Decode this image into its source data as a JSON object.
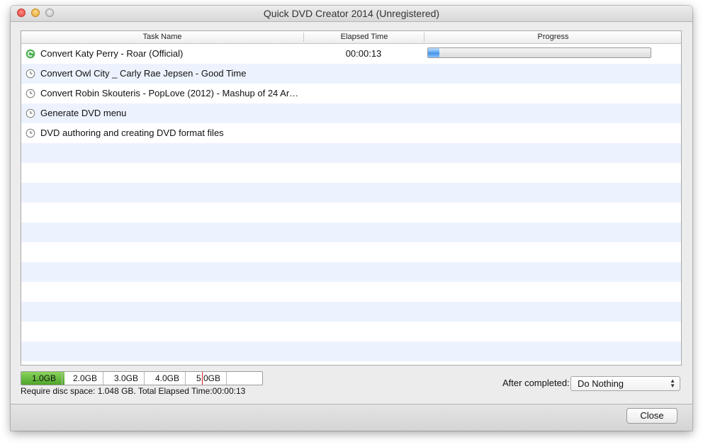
{
  "window": {
    "title": "Quick DVD Creator 2014 (Unregistered)"
  },
  "table": {
    "headers": {
      "task_name": "Task Name",
      "elapsed_time": "Elapsed Time",
      "progress": "Progress"
    },
    "tasks": [
      {
        "name": "Convert Katy Perry - Roar (Official)",
        "elapsed": "00:00:13",
        "progress": 0.05,
        "status_icon": "refresh-icon"
      },
      {
        "name": "Convert Owl City _ Carly Rae Jepsen - Good Time",
        "elapsed": "",
        "status_icon": "clock-icon"
      },
      {
        "name": "Convert Robin Skouteris - PopLove (2012) - Mashup of 24 Ar…",
        "elapsed": "",
        "status_icon": "clock-icon"
      },
      {
        "name": "Generate DVD menu",
        "elapsed": "",
        "status_icon": "clock-icon"
      },
      {
        "name": "DVD authoring and creating DVD format files",
        "elapsed": "",
        "status_icon": "clock-icon"
      }
    ]
  },
  "disc_space": {
    "scale_labels": [
      "1.0GB",
      "2.0GB",
      "3.0GB",
      "4.0GB",
      "5.0GB"
    ],
    "used_gb": 1.048,
    "capacity_mark_gb": 4.7,
    "status_text": "Require disc space: 1.048 GB. Total Elapsed Time:00:00:13"
  },
  "after_completed": {
    "label": "After completed:",
    "value": "Do Nothing"
  },
  "footer": {
    "close_label": "Close"
  },
  "colors": {
    "row_alt": "#edf3fe",
    "disc_used": "#5cb336",
    "progress_fill": "#5ba4f0",
    "capacity_mark": "#e02020"
  }
}
